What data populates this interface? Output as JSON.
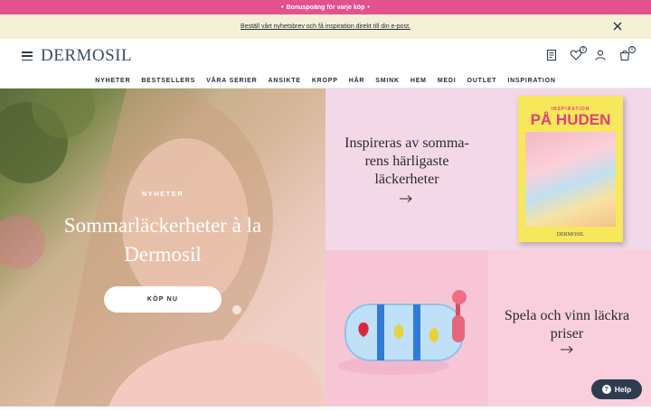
{
  "topbar": {
    "text": "Bonuspoäng för varje köp",
    "bullet_left": "•",
    "bullet_right": "•"
  },
  "newsletter": {
    "text": "Beställ vårt nyhetsbrev och få inspiration direkt till din e-post."
  },
  "header": {
    "logo": "DERMOSIL",
    "wishlist_count": "0",
    "cart_count": "0"
  },
  "nav": {
    "items": [
      "NYHETER",
      "BESTSELLERS",
      "VÅRA SERIER",
      "ANSIKTE",
      "KROPP",
      "HÅR",
      "SMINK",
      "HEM",
      "MEDI",
      "OUTLET",
      "INSPIRATION"
    ]
  },
  "hero": {
    "kicker": "NYHETER",
    "title": "Sommarläckerheter à la Dermosil",
    "button": "KÖP NU"
  },
  "promo_inspiration": {
    "text": "Inspireras av somma-rens härligaste läckerheter",
    "magazine": {
      "kicker": "INSPIRATION",
      "title": "PÅ HUDEN",
      "brand": "DERMOSIL"
    }
  },
  "promo_game": {
    "text": "Spela och vinn läckra priser"
  },
  "help": {
    "label": "Help",
    "symbol": "?"
  },
  "colors": {
    "topbar": "#e3528f",
    "newsbar": "#f4f0d6",
    "navy": "#2d3d4f",
    "promo_pink": "#f3d8e8",
    "promo_rose": "#f7c6d6"
  }
}
